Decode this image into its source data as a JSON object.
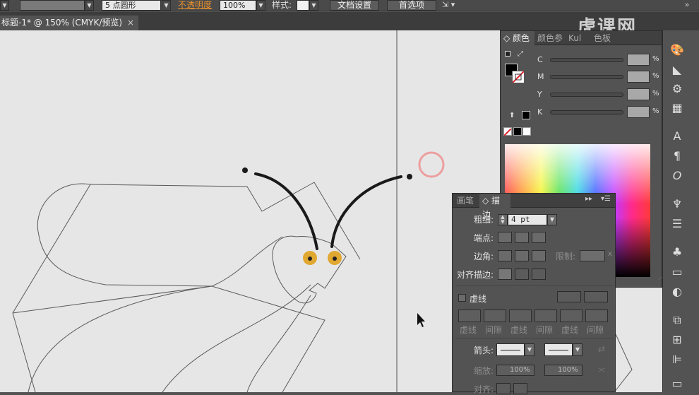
{
  "control_bar": {
    "profile_value": "",
    "brush_value": "5 点圆形",
    "opacity_label": "不透明度",
    "opacity_value": "100%",
    "style_label": "样式:",
    "doc_setup_button": "文档设置",
    "prefs_button": "首选项"
  },
  "document": {
    "tab_title": "标题-1* @ 150% (CMYK/预览)"
  },
  "watermark": "虎课网",
  "color_panel": {
    "tabs": [
      "颜色",
      "颜色参",
      "Kul",
      "色板"
    ],
    "sliders": [
      {
        "label": "C",
        "value": "",
        "unit": "%"
      },
      {
        "label": "M",
        "value": "",
        "unit": "%"
      },
      {
        "label": "Y",
        "value": "",
        "unit": "%"
      },
      {
        "label": "K",
        "value": "",
        "unit": "%"
      }
    ]
  },
  "stroke_panel": {
    "tabs": [
      "画笔",
      "描边"
    ],
    "weight_label": "粗细:",
    "weight_value": "4 pt",
    "cap_label": "端点:",
    "corner_label": "边角:",
    "limit_label": "限制:",
    "limit_suffix": "x",
    "align_label": "对齐描边:",
    "dashed_label": "虚线",
    "dash_labels": [
      "虚线",
      "间隙",
      "虚线",
      "间隙",
      "虚线",
      "间隙"
    ],
    "arrow_label": "箭头:",
    "scale_label": "缩放:",
    "scale_values": [
      "100%",
      "100%"
    ],
    "align_arrow_label": "对齐:"
  },
  "colors": {
    "antenna": "#1a1a1a",
    "eye_fill": "#e0a831",
    "outline": "#5a5a5a",
    "canvas": "#e6e6e6"
  }
}
